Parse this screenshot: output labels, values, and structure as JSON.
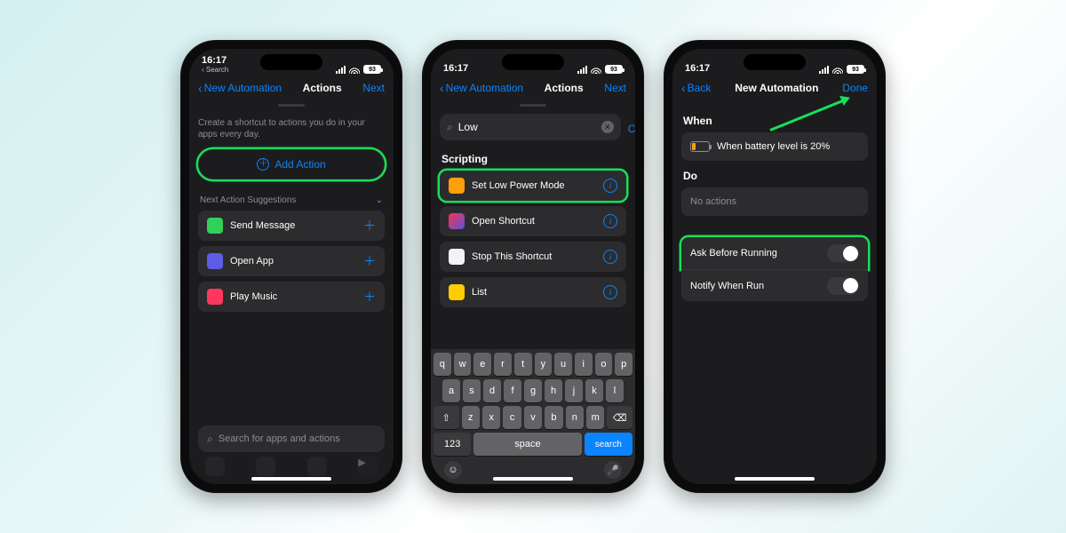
{
  "status": {
    "time": "16:17",
    "miniBack": "Search",
    "battery": "93"
  },
  "phone1": {
    "navBack": "New Automation",
    "navTitle": "Actions",
    "navRight": "Next",
    "hint": "Create a shortcut to actions you do in your apps every day.",
    "addAction": "Add Action",
    "suggestionsHeader": "Next Action Suggestions",
    "rows": [
      {
        "label": "Send Message",
        "cls": "app-green"
      },
      {
        "label": "Open App",
        "cls": "app-purple"
      },
      {
        "label": "Play Music",
        "cls": "app-red"
      }
    ],
    "searchPlaceholder": "Search for apps and actions"
  },
  "phone2": {
    "navBack": "New Automation",
    "navTitle": "Actions",
    "navRight": "Next",
    "searchValue": "Low",
    "cancel": "Cancel",
    "category": "Scripting",
    "rows": [
      {
        "label": "Set Low Power Mode",
        "cls": "app-orange",
        "hl": true
      },
      {
        "label": "Open Shortcut",
        "cls": "app-shortcut"
      },
      {
        "label": "Stop This Shortcut",
        "cls": "app-white"
      },
      {
        "label": "List",
        "cls": "app-yellow"
      }
    ],
    "keys": {
      "r1": [
        "q",
        "w",
        "e",
        "r",
        "t",
        "y",
        "u",
        "i",
        "o",
        "p"
      ],
      "r2": [
        "a",
        "s",
        "d",
        "f",
        "g",
        "h",
        "j",
        "k",
        "l"
      ],
      "r3": [
        "z",
        "x",
        "c",
        "v",
        "b",
        "n",
        "m"
      ],
      "num": "123",
      "space": "space",
      "search": "search"
    }
  },
  "phone3": {
    "navBack": "Back",
    "navTitle": "New Automation",
    "navRight": "Done",
    "when": "When",
    "whenCell": "When battery level is 20%",
    "do": "Do",
    "doCell": "No actions",
    "toggles": [
      {
        "label": "Ask Before Running",
        "on": true,
        "hl": true
      },
      {
        "label": "Notify When Run",
        "on": true
      }
    ]
  }
}
